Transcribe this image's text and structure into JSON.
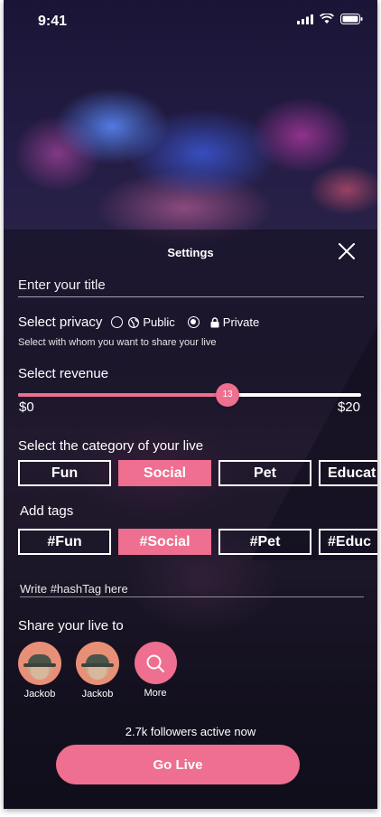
{
  "status_bar": {
    "time": "9:41"
  },
  "settings": {
    "title": "Settings",
    "title_placeholder": "Enter your title",
    "privacy": {
      "label": "Select privacy",
      "options": [
        {
          "label": "Public",
          "selected": false
        },
        {
          "label": "Private",
          "selected": true
        }
      ],
      "hint": "Select with whom you want to share your live"
    },
    "revenue": {
      "label": "Select revenue",
      "min_label": "$0",
      "max_label": "$20",
      "min": 0,
      "max": 20,
      "value": 13,
      "value_label": "13"
    },
    "category": {
      "label": "Select the category of your live",
      "chips": [
        {
          "label": "Fun",
          "active": false
        },
        {
          "label": "Social",
          "active": true
        },
        {
          "label": "Pet",
          "active": false
        },
        {
          "label": "Educat",
          "active": false
        }
      ]
    },
    "tags": {
      "label": "Add tags",
      "chips": [
        {
          "label": "#Fun",
          "active": false
        },
        {
          "label": "#Social",
          "active": true
        },
        {
          "label": "#Pet",
          "active": false
        },
        {
          "label": "#Educ",
          "active": false
        }
      ],
      "input_placeholder": "Write #hashTag here"
    },
    "share": {
      "label": "Share your live to",
      "contacts": [
        {
          "name": "Jackob"
        },
        {
          "name": "Jackob"
        }
      ],
      "more_label": "More"
    },
    "followers_text": "2.7k followers active now",
    "go_live_label": "Go Live"
  },
  "colors": {
    "accent": "#ee6f8f",
    "sheet": "#141022"
  }
}
